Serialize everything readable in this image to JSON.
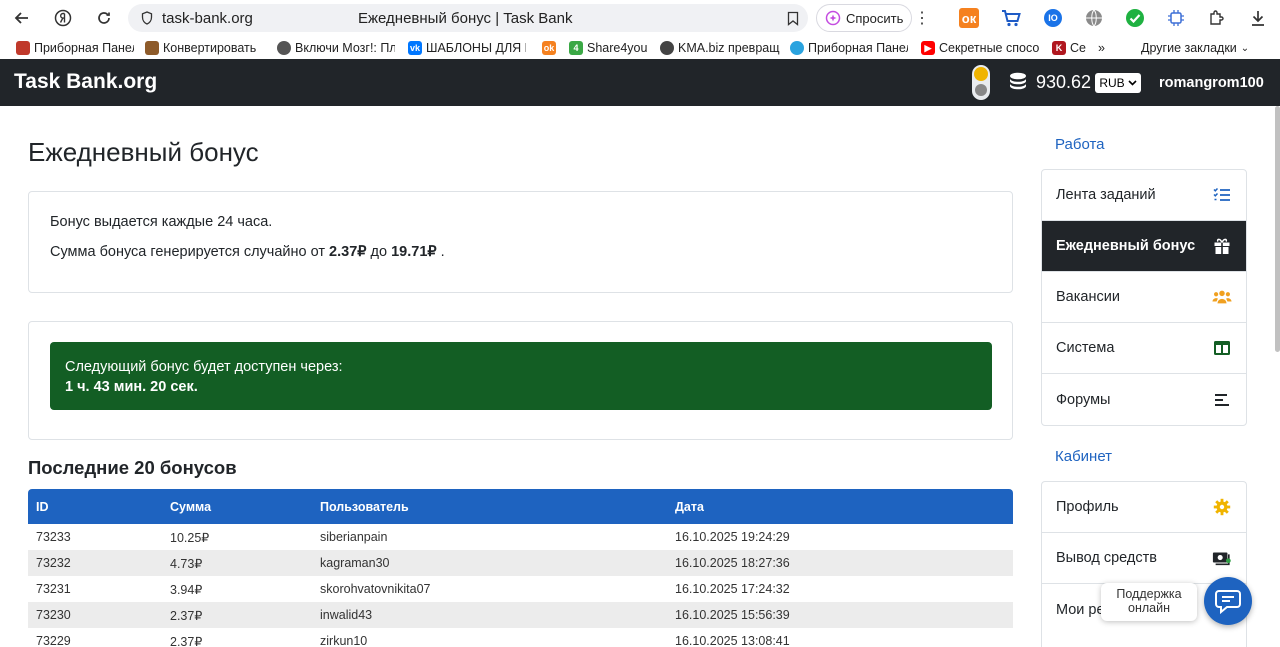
{
  "browser": {
    "url": "task-bank.org",
    "tab_title": "Ежедневный бонус | Task Bank",
    "ask_label": "Спросить",
    "bookmarks": [
      {
        "label": "Приборная Панель",
        "color": "#c0392b",
        "icon": "dashboard-icon"
      },
      {
        "label": "Конвертировать",
        "color": "#8e5b2a",
        "icon": "converter-icon"
      },
      {
        "label": "Включи Мозг!: Пл",
        "color": "#555555",
        "icon": "brain-icon"
      },
      {
        "label": "ШАБЛОНЫ ДЛЯ Р",
        "color": "#0077ff",
        "icon": "vk-icon"
      },
      {
        "label": "",
        "color": "#f5811f",
        "icon": "ok-icon"
      },
      {
        "label": "Share4you",
        "color": "#3aa845",
        "icon": "share4you-icon"
      },
      {
        "label": "KMA.biz превращ",
        "color": "#444444",
        "icon": "kma-icon"
      },
      {
        "label": "Приборная Панел",
        "color": "#2aa3df",
        "icon": "telegram-icon"
      },
      {
        "label": "Секретные спосо",
        "color": "#ff0000",
        "icon": "youtube-icon"
      },
      {
        "label": "Се",
        "color": "#b0171f",
        "icon": "k-icon"
      }
    ],
    "other_bookmarks": "Другие закладки"
  },
  "header": {
    "brand": "Task Bank.org",
    "balance": "930.62",
    "currency": "RUB",
    "username": "romangrom100"
  },
  "main": {
    "title": "Ежедневный бонус",
    "info_line1": "Бонус выдается каждые 24 часа.",
    "info_line2_prefix": "Сумма бонуса генерируется случайно от ",
    "min_amount": "2.37₽",
    "info_line2_mid": " до ",
    "max_amount": "19.71₽",
    "info_line2_suffix": " .",
    "next_bonus_label": "Следующий бонус будет доступен через:",
    "next_bonus_time": "1 ч. 43 мин. 20 сек.",
    "recent_title": "Последние 20 бонусов",
    "table": {
      "headers": [
        "ID",
        "Сумма",
        "Пользователь",
        "Дата"
      ],
      "rows": [
        [
          "73233",
          "10.25₽",
          "siberianpain",
          "16.10.2025 19:24:29"
        ],
        [
          "73232",
          "4.73₽",
          "kagraman30",
          "16.10.2025 18:27:36"
        ],
        [
          "73231",
          "3.94₽",
          "skorohvatovnikita07",
          "16.10.2025 17:24:32"
        ],
        [
          "73230",
          "2.37₽",
          "inwalid43",
          "16.10.2025 15:56:39"
        ],
        [
          "73229",
          "2.37₽",
          "zirkun10",
          "16.10.2025 13:08:41"
        ]
      ]
    }
  },
  "sidebar": {
    "work_heading": "Работа",
    "work_items": [
      {
        "label": "Лента заданий",
        "icon": "task-list-icon"
      },
      {
        "label": "Ежедневный бонус",
        "icon": "gift-icon"
      },
      {
        "label": "Вакансии",
        "icon": "users-icon"
      },
      {
        "label": "Система",
        "icon": "columns-icon"
      },
      {
        "label": "Форумы",
        "icon": "align-left-icon"
      }
    ],
    "cabinet_heading": "Кабинет",
    "cabinet_items": [
      {
        "label": "Профиль",
        "icon": "gear-icon"
      },
      {
        "label": "Вывод средств",
        "icon": "money-icon"
      },
      {
        "label": "Мои ре",
        "icon": ""
      }
    ]
  },
  "support": {
    "tooltip": "Поддержка онлайн"
  },
  "colors": {
    "header_bg": "#212529",
    "accent": "#1e63c0",
    "alert_bg": "#135e24"
  }
}
